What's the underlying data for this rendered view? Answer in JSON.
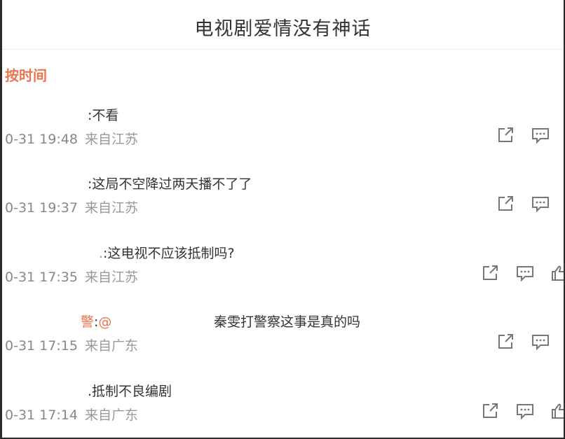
{
  "header": {
    "title": "电视剧爱情没有神话"
  },
  "sort": {
    "active_label": "按时间"
  },
  "comments": [
    {
      "user_frag": "",
      "text": ":不看",
      "at": "",
      "text_after": "",
      "time": "0-31 19:48",
      "source": "来自江苏"
    },
    {
      "user_frag": "",
      "text": ":这局不空降过两天播不了了",
      "at": "",
      "text_after": "",
      "time": "0-31 19:37",
      "source": "来自江苏"
    },
    {
      "user_frag": ".",
      "text": ":这电视不应该抵制吗?",
      "at": "",
      "text_after": "",
      "time": "0-31 17:35",
      "source": "来自江苏"
    },
    {
      "user_frag": "警",
      "text": ":",
      "at": "@",
      "text_after": "秦雯打警察这事是真的吗",
      "time": "0-31 17:15",
      "source": "来自广东"
    },
    {
      "user_frag": "",
      "text": ".抵制不良编剧",
      "at": "",
      "text_after": "",
      "time": "0-31 17:14",
      "source": "来自广东"
    }
  ],
  "icons": {
    "share": "share-icon",
    "comment": "comment-icon",
    "like": "like-icon"
  }
}
